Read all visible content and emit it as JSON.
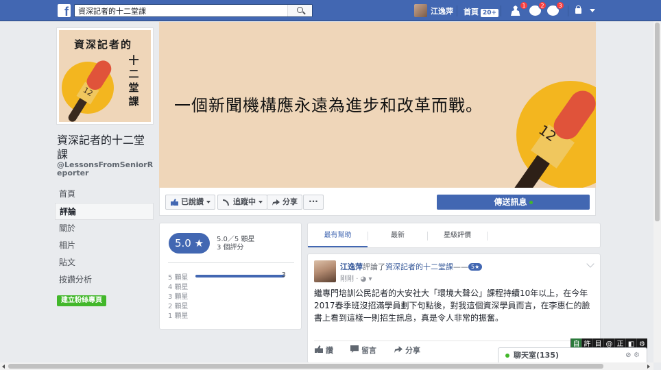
{
  "topbar": {
    "search_value": "資深記者的十二堂課",
    "user_name": "江逸萍",
    "home_label": "首頁",
    "home_badge": "20+",
    "friend_badge": "1",
    "message_badge": "2",
    "notif_badge": "3"
  },
  "page": {
    "name": "資深記者的十二堂課",
    "handle": "@LessonsFromSeniorReporter",
    "logo_title": "資深記者的",
    "logo_vertical": "十二堂課",
    "logo_mic_number": "12"
  },
  "sidebar": {
    "items": [
      {
        "label": "首頁"
      },
      {
        "label": "評論"
      },
      {
        "label": "關於"
      },
      {
        "label": "相片"
      },
      {
        "label": "貼文"
      },
      {
        "label": "按讚分析"
      }
    ],
    "active_index": 1,
    "create_button": "建立粉絲專頁"
  },
  "cover": {
    "slogan": "一個新聞機構應永遠為進步和改革而戰。",
    "mic_number": "12"
  },
  "actions": {
    "liked": "已說讚",
    "following": "追蹤中",
    "share": "分享",
    "more": "···",
    "send_message": "傳送訊息"
  },
  "rating": {
    "score": "5.0 ★",
    "summary_line1": "5.0／5 顆星",
    "summary_line2": "3 個評分",
    "rows": [
      {
        "label": "5 顆星",
        "fraction": 1.0,
        "count": "3"
      },
      {
        "label": "4 顆星",
        "fraction": 0,
        "count": ""
      },
      {
        "label": "3 顆星",
        "fraction": 0,
        "count": ""
      },
      {
        "label": "2 顆星",
        "fraction": 0,
        "count": ""
      },
      {
        "label": "1 顆星",
        "fraction": 0,
        "count": ""
      }
    ]
  },
  "review_tabs": [
    {
      "label": "最有幫助"
    },
    {
      "label": "最新"
    },
    {
      "label": "星級評價"
    }
  ],
  "post": {
    "author": "江逸萍",
    "verb": "評論了",
    "page": "資深記者的十二堂課",
    "dash": "——",
    "stars": "5★",
    "time": "剛剛",
    "privacy": "· ◕ ▾",
    "body": "繼專門培訓公民記者的大安社大「環境大聲公」課程持續10年以上，在今年2017春季班沒招滿學員劃下句點後，對我這個資深學員而言，在李惠仁的臉書上看到這樣一則招生訊息，真是令人非常的振奮。",
    "like": "讚",
    "comment": "留言",
    "share": "分享"
  },
  "ime": {
    "keys": [
      "自",
      "許",
      "目",
      "@",
      "正",
      "◧",
      "⚙"
    ]
  },
  "chat": {
    "label": "聊天室(135)",
    "tools": "⊘ ⚙"
  }
}
